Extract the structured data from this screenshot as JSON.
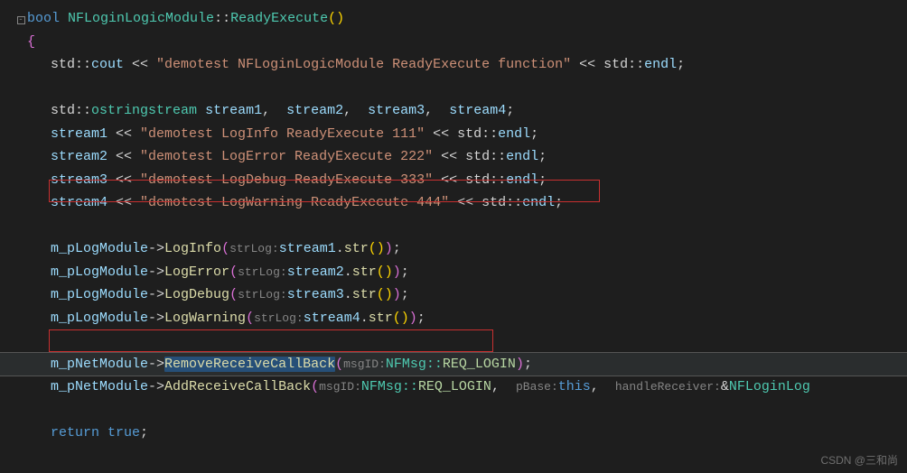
{
  "sig": {
    "ret": "bool",
    "cls": "NFLoginLogicModule",
    "sep": "::",
    "fn": "ReadyExecute",
    "parens": "()"
  },
  "brace_open": "{",
  "cout": {
    "ns": "std::",
    "obj": "cout",
    "op": " << ",
    "str": "\"demotest NFLoginLogicModule ReadyExecute function\"",
    "endl": "endl",
    "semi": ";"
  },
  "decl": {
    "ns": "std::",
    "type": "ostringstream",
    "v1": "stream1",
    "v2": "stream2",
    "v3": "stream3",
    "v4": "stream4",
    "comma": ", ",
    "semi": ";"
  },
  "s1": {
    "var": "stream1",
    "op": " << ",
    "str": "\"demotest LogInfo ReadyExecute 111\"",
    "ns": "std::",
    "endl": "endl",
    "semi": ";"
  },
  "s2": {
    "var": "stream2",
    "op": " << ",
    "str": "\"demotest LogError ReadyExecute 222\"",
    "ns": "std::",
    "endl": "endl",
    "semi": ";"
  },
  "s3": {
    "var": "stream3",
    "op": " << ",
    "str": "\"demotest LogDebug ReadyExecute 333\"",
    "ns": "std::",
    "endl": "endl",
    "semi": ";"
  },
  "s4": {
    "var": "stream4",
    "op": " << ",
    "str": "\"demotest LogWarning ReadyExecute 444\"",
    "ns": "std::",
    "endl": "endl",
    "semi": ";"
  },
  "log1": {
    "obj": "m_pLogModule",
    "arrow": "->",
    "fn": "LogInfo",
    "hint": "strLog:",
    "arg": "stream1",
    "dot": ".",
    "m": "str",
    "p2": "()",
    "semi": ";"
  },
  "log2": {
    "obj": "m_pLogModule",
    "arrow": "->",
    "fn": "LogError",
    "hint": "strLog:",
    "arg": "stream2",
    "dot": ".",
    "m": "str",
    "p2": "()",
    "semi": ";"
  },
  "log3": {
    "obj": "m_pLogModule",
    "arrow": "->",
    "fn": "LogDebug",
    "hint": "strLog:",
    "arg": "stream3",
    "dot": ".",
    "m": "str",
    "p2": "()",
    "semi": ";"
  },
  "log4": {
    "obj": "m_pLogModule",
    "arrow": "->",
    "fn": "LogWarning",
    "hint": "strLog:",
    "arg": "stream4",
    "dot": ".",
    "m": "str",
    "p2": "()",
    "semi": ";"
  },
  "net1": {
    "obj": "m_pNetModule",
    "arrow": "->",
    "fn": "RemoveReceiveCallBack",
    "hint": "msgID:",
    "ns": "NFMsg::",
    "enum": "REQ_LOGIN",
    "semi": ";"
  },
  "net2": {
    "obj": "m_pNetModule",
    "arrow": "->",
    "fn": "AddReceiveCallBack",
    "hint1": "msgID:",
    "ns": "NFMsg::",
    "enum": "REQ_LOGIN",
    "comma": ", ",
    "hint2": "pBase:",
    "this": "this",
    "hint3": "handleReceiver:",
    "amp": "&",
    "cb": "NFLoginLog"
  },
  "ret": {
    "kw": "return",
    "val": "true",
    "semi": ";"
  },
  "watermark": "CSDN @三和尚"
}
